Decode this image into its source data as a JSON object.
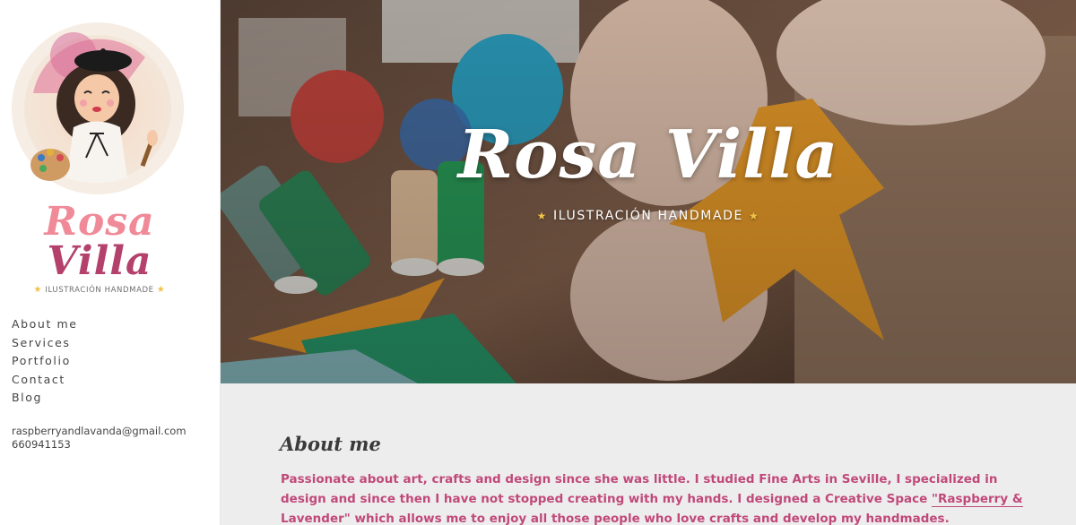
{
  "brand": {
    "name_line1": "Rosa",
    "name_line2": "Villa",
    "tagline": "ILUSTRACIÓN HANDMADE",
    "star": "★"
  },
  "nav": {
    "items": [
      {
        "label": "About me"
      },
      {
        "label": "Services"
      },
      {
        "label": "Portfolio"
      },
      {
        "label": "Contact"
      },
      {
        "label": "Blog"
      }
    ]
  },
  "contact": {
    "email": "raspberryandlavanda@gmail.com",
    "phone": "660941153"
  },
  "hero": {
    "title": "Rosa Villa",
    "subtitle": "ILUSTRACIÓN HANDMADE",
    "star": "★"
  },
  "about": {
    "heading": "About me",
    "text_before_link": "Passionate about art, crafts and design since she was little. I studied Fine Arts in Seville, I specialized in design and since then I have not stopped creating with my hands. I designed a Creative Space ",
    "link_text": "\"Raspberry & Lavender\"",
    "text_after_link": " which allows me to enjoy all those people who love crafts and develop my handmades."
  },
  "colors": {
    "accent_pink": "#c0497a",
    "brand_light_pink": "#f08a98",
    "brand_dark_pink": "#b3416c",
    "star_gold": "#f2c248",
    "content_bg": "#eeeded"
  }
}
